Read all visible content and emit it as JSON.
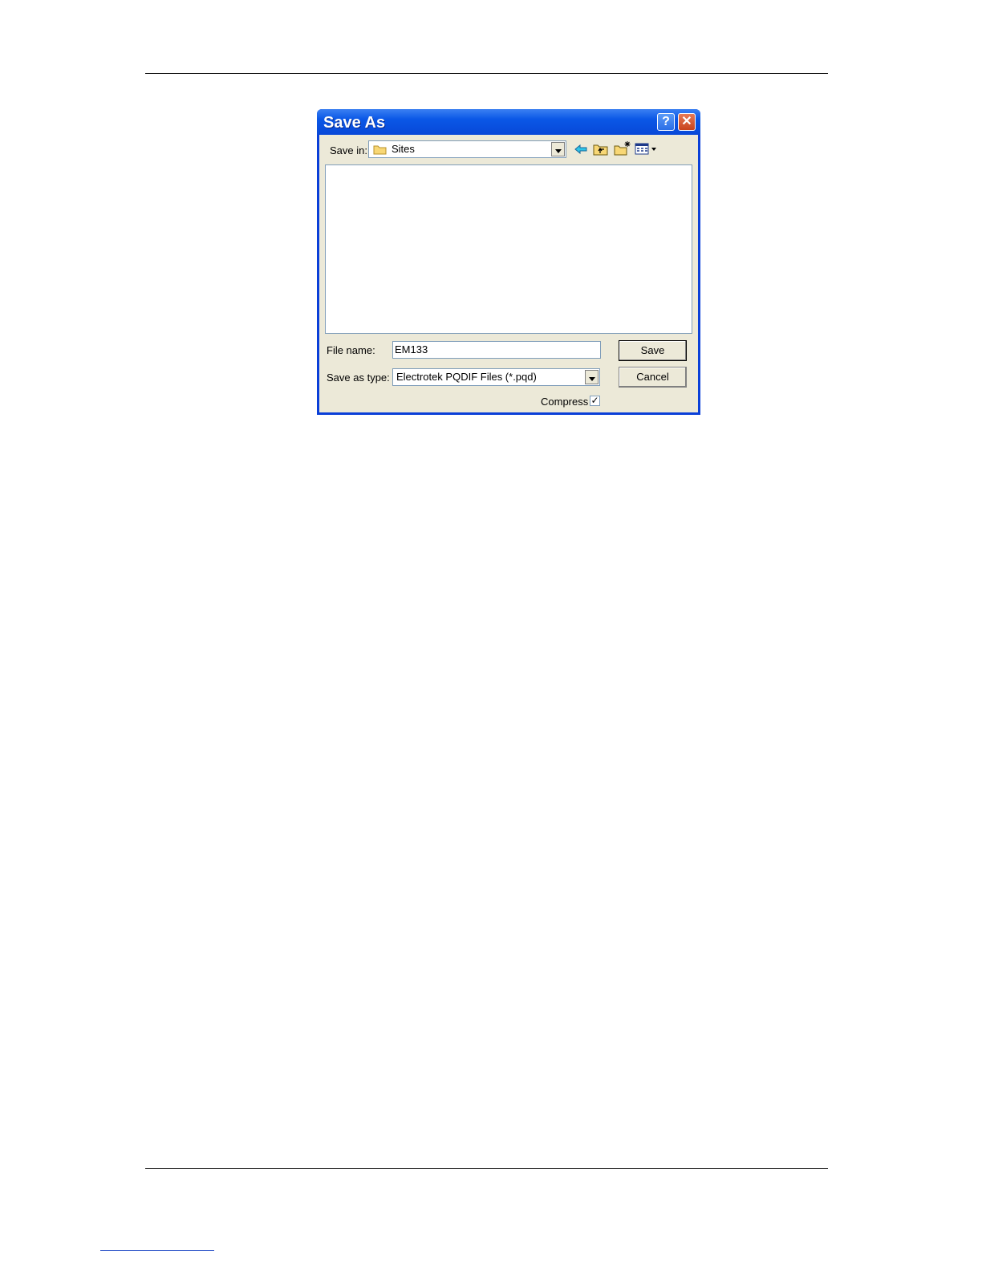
{
  "dialog": {
    "title": "Save As",
    "help_glyph": "?",
    "close_glyph": "✕",
    "save_in_label": "Save in:",
    "save_in_value": "Sites",
    "file_name_label": "File name:",
    "file_name_value": "EM133",
    "save_as_type_label": "Save as type:",
    "save_as_type_value": "Electrotek PQDIF Files (*.pqd)",
    "save_button": "Save",
    "cancel_button": "Cancel",
    "compress_label": "Compress",
    "compress_checked": true,
    "check_glyph": "✓"
  },
  "icons": [
    "folder-icon",
    "back-icon",
    "up-folder-icon",
    "new-folder-icon",
    "view-menu-icon"
  ]
}
